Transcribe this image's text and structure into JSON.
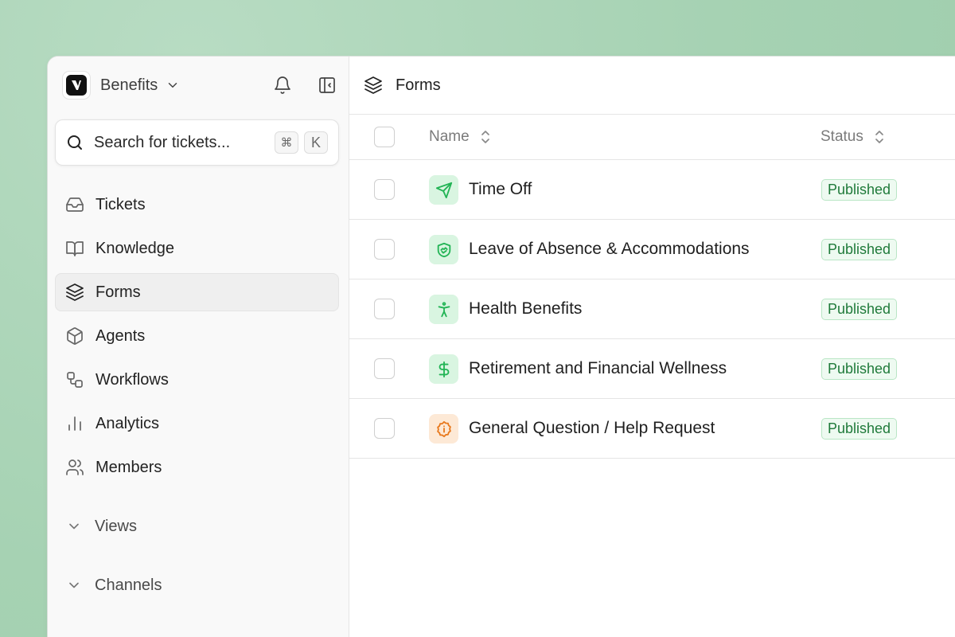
{
  "workspace": {
    "name": "Benefits"
  },
  "search": {
    "placeholder": "Search for tickets...",
    "shortcut_mod": "⌘",
    "shortcut_key": "K"
  },
  "sidebar": {
    "items": [
      {
        "label": "Tickets",
        "icon": "inbox-icon",
        "active": false
      },
      {
        "label": "Knowledge",
        "icon": "book-icon",
        "active": false
      },
      {
        "label": "Forms",
        "icon": "layers-icon",
        "active": true
      },
      {
        "label": "Agents",
        "icon": "cube-icon",
        "active": false
      },
      {
        "label": "Workflows",
        "icon": "workflow-icon",
        "active": false
      },
      {
        "label": "Analytics",
        "icon": "bar-chart-icon",
        "active": false
      },
      {
        "label": "Members",
        "icon": "users-icon",
        "active": false
      }
    ],
    "sections": [
      {
        "label": "Views"
      },
      {
        "label": "Channels"
      }
    ]
  },
  "main": {
    "title": "Forms",
    "columns": {
      "name": "Name",
      "status": "Status"
    },
    "rows": [
      {
        "name": "Time Off",
        "status": "Published",
        "icon": "send-icon",
        "icon_color": "#22b455",
        "icon_bg": "#d9f5e1"
      },
      {
        "name": "Leave of Absence & Accommodations",
        "status": "Published",
        "icon": "handshake-icon",
        "icon_color": "#22b455",
        "icon_bg": "#d9f5e1"
      },
      {
        "name": "Health Benefits",
        "status": "Published",
        "icon": "accessibility-icon",
        "icon_color": "#22b455",
        "icon_bg": "#d9f5e1"
      },
      {
        "name": "Retirement and Financial Wellness",
        "status": "Published",
        "icon": "dollar-icon",
        "icon_color": "#22b455",
        "icon_bg": "#d9f5e1"
      },
      {
        "name": "General Question / Help Request",
        "status": "Published",
        "icon": "info-badge-icon",
        "icon_color": "#e8791d",
        "icon_bg": "#fde9d6"
      }
    ]
  },
  "colors": {
    "accent_green": "#22b455",
    "accent_orange": "#e8791d",
    "badge_text": "#1f7a3a"
  }
}
